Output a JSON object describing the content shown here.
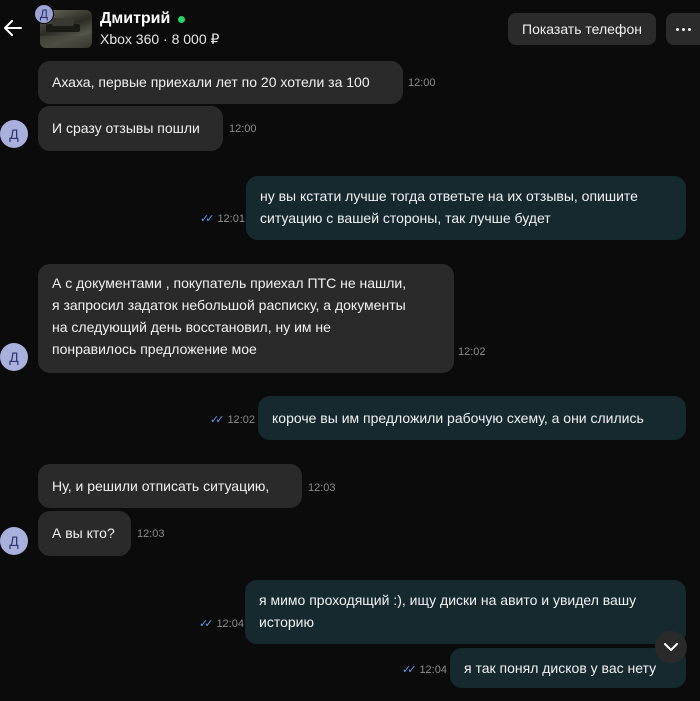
{
  "header": {
    "contact_name": "Дмитрий",
    "avatar_letter": "Д",
    "listing": "Xbox 360 · 8 000 ₽",
    "show_phone_label": "Показать телефон",
    "online_color": "#2bd26b"
  },
  "avatar_letter": "Д",
  "messages": [
    {
      "dir": "in",
      "text": "Ахаха, первые приехали лет по 20 хотели за 100",
      "time": "12:00"
    },
    {
      "dir": "in",
      "text": "И сразу отзывы пошли",
      "time": "12:00"
    },
    {
      "dir": "out",
      "lines": [
        "ну вы кстати лучше тогда ответьте на их отзывы, опишите",
        "ситуацию с вашей стороны, так лучше будет"
      ],
      "time": "12:01"
    },
    {
      "dir": "in",
      "lines": [
        "А с документами  , покупатель приехал  ПТС не нашли,",
        "я запросил задаток небольшой расписку, а документы",
        "на следующий день восстановил, ну им не",
        "понравилось предложение мое"
      ],
      "time": "12:02"
    },
    {
      "dir": "out",
      "text": "короче вы им предложили рабочую схему, а они слились",
      "time": "12:02"
    },
    {
      "dir": "in",
      "text": "Ну, и решили  отписать ситуацию,",
      "time": "12:03"
    },
    {
      "dir": "in",
      "text": "А вы кто?",
      "time": "12:03"
    },
    {
      "dir": "out",
      "lines": [
        "я мимо проходящий :), ищу диски на авито и увидел вашу",
        "историю"
      ],
      "time": "12:04"
    },
    {
      "dir": "out",
      "text": "я так понял дисков у вас нету",
      "time": "12:04"
    }
  ],
  "colors": {
    "background": "#0b0b0b",
    "incoming_bubble": "#2a2a2a",
    "outgoing_bubble": "#15292f",
    "read_checks": "#5a9bf0",
    "avatar": "#aab0de"
  },
  "icons": [
    "back-arrow-icon",
    "more-dots-icon",
    "double-check-icon",
    "chevron-down-icon"
  ]
}
